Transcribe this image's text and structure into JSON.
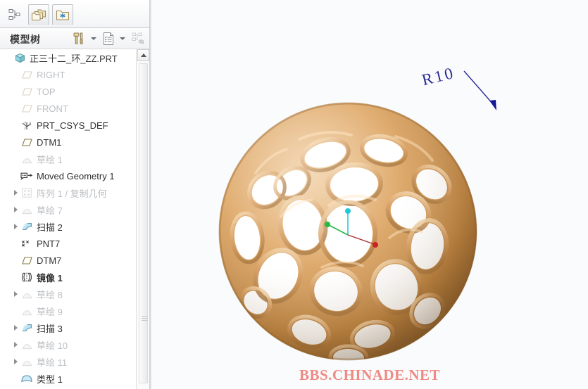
{
  "colors": {
    "panel_bg": "#ffffff",
    "viewport_bg": "#fafbfc",
    "model_gold_light": "#e6b77e",
    "model_gold_mid": "#d49a5c",
    "model_gold_dark": "#a8713a",
    "annotation_blue": "#2a2a96",
    "watermark_pink": "#ef8a84",
    "axis_x_red": "#cc2222",
    "axis_y_green": "#22bb44",
    "axis_z_cyan": "#22c8d8"
  },
  "tabstrip": {
    "tabs": [
      {
        "name": "model-tree-tab",
        "icon": "tree-hierarchy-icon",
        "selected": false,
        "label": ""
      },
      {
        "name": "folder-browser-tab",
        "icon": "folders-icon",
        "selected": true,
        "label": ""
      },
      {
        "name": "favorites-tab",
        "icon": "folder-star-icon",
        "selected": true,
        "label": ""
      }
    ]
  },
  "tree_header": {
    "title": "模型树",
    "buttons": [
      {
        "name": "tools-button",
        "icon": "hammer-tools-icon"
      },
      {
        "name": "tools-dropdown",
        "icon": "chevron-down-icon"
      },
      {
        "name": "settings-list-button",
        "icon": "list-document-icon"
      },
      {
        "name": "settings-dropdown",
        "icon": "chevron-down-icon"
      },
      {
        "name": "tree-filter-button",
        "icon": "tree-filter-disabled-icon"
      }
    ]
  },
  "tree": {
    "items": [
      {
        "label": "正三十二_环_ZZ.PRT",
        "icon": "part-cube-icon",
        "indent": 0,
        "expander": false,
        "dim": false,
        "bold": false
      },
      {
        "label": "RIGHT",
        "icon": "datum-plane-icon",
        "indent": 1,
        "expander": false,
        "dim": true,
        "bold": false
      },
      {
        "label": "TOP",
        "icon": "datum-plane-icon",
        "indent": 1,
        "expander": false,
        "dim": true,
        "bold": false
      },
      {
        "label": "FRONT",
        "icon": "datum-plane-icon",
        "indent": 1,
        "expander": false,
        "dim": true,
        "bold": false
      },
      {
        "label": "PRT_CSYS_DEF",
        "icon": "csys-icon",
        "indent": 1,
        "expander": false,
        "dim": false,
        "bold": false
      },
      {
        "label": "DTM1",
        "icon": "datum-plane-icon",
        "indent": 1,
        "expander": false,
        "dim": false,
        "bold": false
      },
      {
        "label": "草绘 1",
        "icon": "sketch-icon",
        "indent": 1,
        "expander": false,
        "dim": true,
        "bold": false
      },
      {
        "label": "Moved Geometry 1",
        "icon": "moved-geometry-icon",
        "indent": 1,
        "expander": false,
        "dim": false,
        "bold": false
      },
      {
        "label": "阵列 1 / 复制几何",
        "icon": "pattern-icon",
        "indent": 1,
        "expander": true,
        "dim": true,
        "bold": false
      },
      {
        "label": "草绘 7",
        "icon": "sketch-icon",
        "indent": 1,
        "expander": true,
        "dim": true,
        "bold": false
      },
      {
        "label": "扫描 2",
        "icon": "sweep-icon",
        "indent": 1,
        "expander": true,
        "dim": false,
        "bold": false
      },
      {
        "label": "PNT7",
        "icon": "point-icon",
        "indent": 1,
        "expander": false,
        "dim": false,
        "bold": false
      },
      {
        "label": "DTM7",
        "icon": "datum-plane-icon",
        "indent": 1,
        "expander": false,
        "dim": false,
        "bold": false
      },
      {
        "label": "镜像 1",
        "icon": "mirror-icon",
        "indent": 1,
        "expander": false,
        "dim": false,
        "bold": true
      },
      {
        "label": "草绘 8",
        "icon": "sketch-icon",
        "indent": 1,
        "expander": true,
        "dim": true,
        "bold": false
      },
      {
        "label": "草绘 9",
        "icon": "sketch-icon",
        "indent": 1,
        "expander": false,
        "dim": true,
        "bold": false
      },
      {
        "label": "扫描 3",
        "icon": "sweep-icon",
        "indent": 1,
        "expander": true,
        "dim": false,
        "bold": false
      },
      {
        "label": "草绘 10",
        "icon": "sketch-icon",
        "indent": 1,
        "expander": true,
        "dim": true,
        "bold": false
      },
      {
        "label": "草绘 11",
        "icon": "sketch-icon",
        "indent": 1,
        "expander": true,
        "dim": true,
        "bold": false
      },
      {
        "label": "类型 1",
        "icon": "type-icon",
        "indent": 1,
        "expander": false,
        "dim": false,
        "bold": false
      }
    ]
  },
  "scrollbar": {
    "up_arrow": "scroll-up-icon",
    "thumb": "scroll-thumb"
  },
  "viewport": {
    "annotation": {
      "text": "R10",
      "color": "#2a2a96"
    },
    "csys": {
      "x_axis_color": "#cc2222",
      "y_axis_color": "#22bb44",
      "z_axis_color": "#22c8d8"
    },
    "watermark": "BBS.CHINADE.NET",
    "model_description": "golden lattice sphere"
  }
}
